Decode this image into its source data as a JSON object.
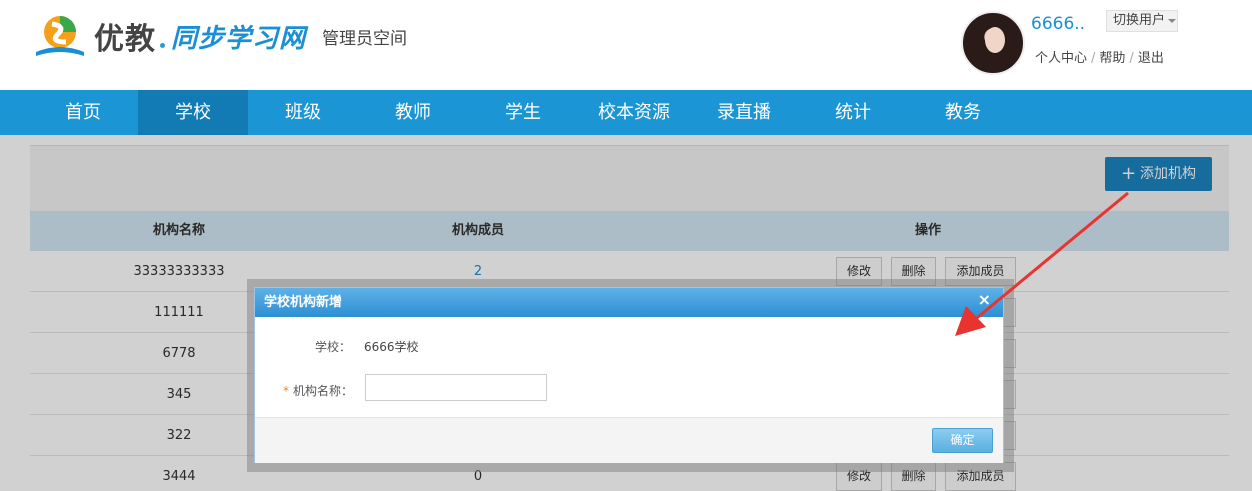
{
  "header": {
    "logo_text_1": "优教",
    "logo_text_2": "同步学习网",
    "space_label": "管理员空间",
    "user_name": "6666..",
    "switch_user": "切换用户",
    "links": [
      "个人中心",
      "帮助",
      "退出"
    ]
  },
  "nav": {
    "items": [
      "首页",
      "学校",
      "班级",
      "教师",
      "学生",
      "校本资源",
      "录直播",
      "统计",
      "教务"
    ],
    "active": "学校"
  },
  "toolbar": {
    "add_org": "添加机构"
  },
  "table": {
    "headers": [
      "机构名称",
      "机构成员",
      "操作"
    ],
    "rows": [
      {
        "name": "33333333333",
        "members": "2"
      },
      {
        "name": "111111",
        "members": ""
      },
      {
        "name": "6778",
        "members": ""
      },
      {
        "name": "345",
        "members": ""
      },
      {
        "name": "322",
        "members": ""
      },
      {
        "name": "3444",
        "members": "0"
      }
    ],
    "actions": [
      "修改",
      "删除",
      "添加成员"
    ]
  },
  "dialog": {
    "title": "学校机构新增",
    "close": "×",
    "school_label": "学校：",
    "school_value": "6666学校",
    "required_mark": "*",
    "name_label": "机构名称：",
    "name_value": "",
    "confirm": "确定"
  },
  "colors": {
    "nav_bg": "#1c95d4",
    "nav_active": "#137bb3",
    "accent_link": "#1a8fd4",
    "annotation_arrow": "#e8332f"
  }
}
